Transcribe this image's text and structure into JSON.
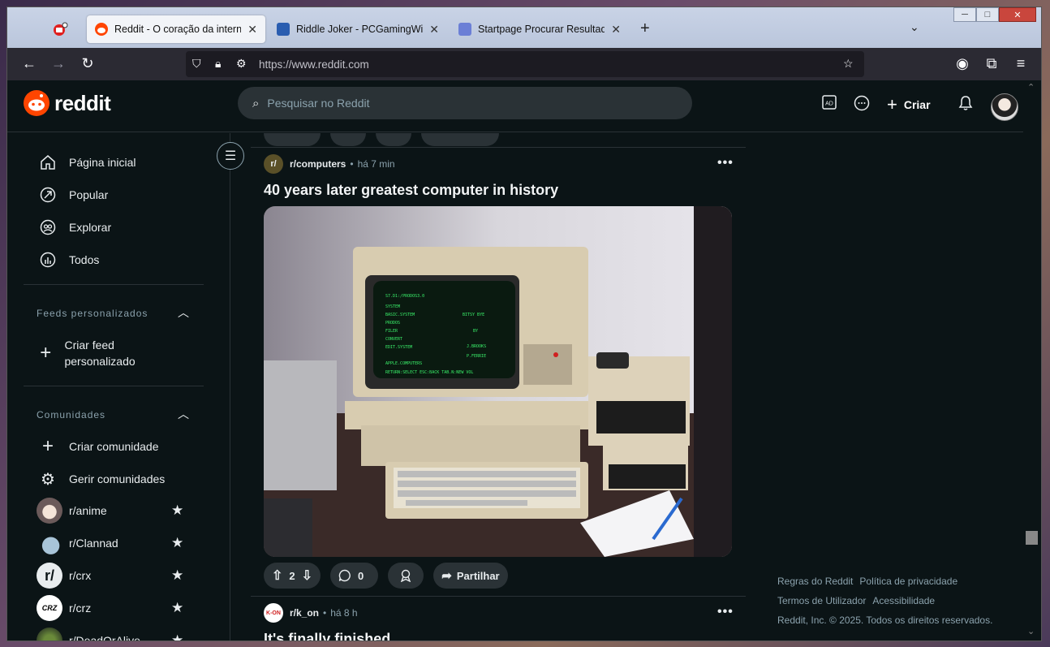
{
  "browser": {
    "tabs": [
      {
        "title": "Reddit - O coração da internet",
        "active": true
      },
      {
        "title": "Riddle Joker - PCGamingWiki P",
        "active": false
      },
      {
        "title": "Startpage Procurar Resultados",
        "active": false
      }
    ],
    "url": "https://www.reddit.com"
  },
  "header": {
    "logo_text": "reddit",
    "search_placeholder": "Pesquisar no Reddit",
    "create_label": "Criar"
  },
  "sidebar": {
    "nav": [
      {
        "label": "Página inicial",
        "icon": "home-icon"
      },
      {
        "label": "Popular",
        "icon": "popular-icon"
      },
      {
        "label": "Explorar",
        "icon": "explore-icon"
      },
      {
        "label": "Todos",
        "icon": "all-icon"
      }
    ],
    "feeds_heading": "Feeds personalizados",
    "create_feed": "Criar feed personalizado",
    "communities_heading": "Comunidades",
    "create_community": "Criar comunidade",
    "manage_communities": "Gerir comunidades",
    "communities": [
      {
        "name": "r/anime"
      },
      {
        "name": "r/Clannad"
      },
      {
        "name": "r/crx"
      },
      {
        "name": "r/crz"
      },
      {
        "name": "r/DeadOrAlive"
      }
    ]
  },
  "feed": {
    "post1": {
      "subreddit": "r/computers",
      "time": "há 7 min",
      "title": "40 years later greatest computer in history",
      "votes": "2",
      "comments": "0",
      "share_label": "Partilhar"
    },
    "post2": {
      "subreddit": "r/k_on",
      "time": "há 8 h",
      "title": "It's finally finished"
    }
  },
  "footer": {
    "rules": "Regras do Reddit",
    "privacy": "Política de privacidade",
    "terms": "Termos de Utilizador",
    "accessibility": "Acessibilidade",
    "copyright": "Reddit, Inc. © 2025. Todos os direitos reservados."
  },
  "colors": {
    "reddit_orange": "#ff4500",
    "background": "#0b1416",
    "pill": "#2a3236"
  }
}
